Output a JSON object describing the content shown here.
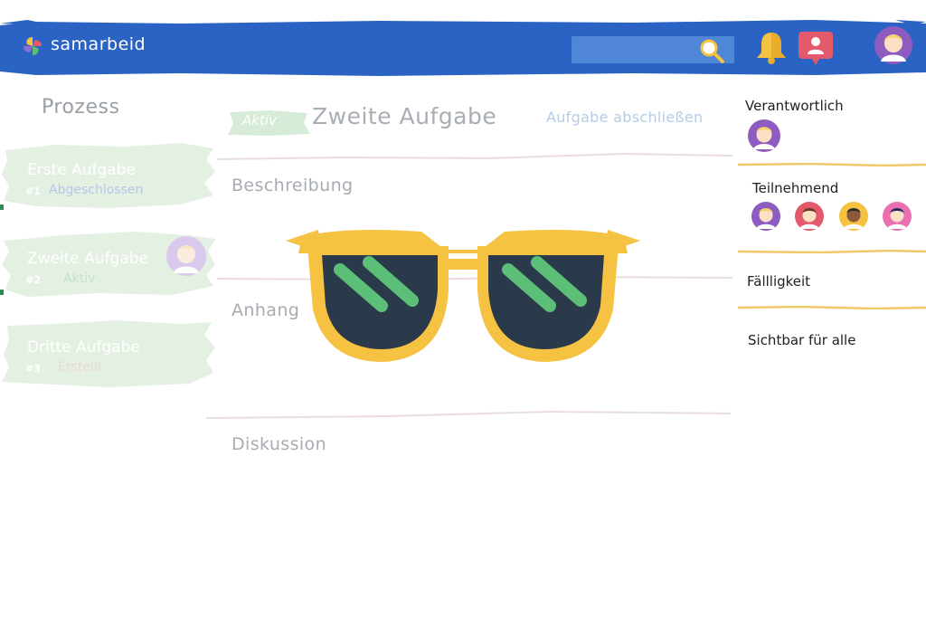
{
  "app": {
    "name": "samarbeid"
  },
  "header": {
    "icons": [
      "logo-icon",
      "search-icon",
      "bell-icon",
      "profile-badge-icon",
      "user-avatar"
    ],
    "colors": {
      "bar": "#2a63c4",
      "search": "#4f86d6",
      "bell": "#f5c242",
      "badge": "#e55a6a"
    }
  },
  "process": {
    "title": "Prozess",
    "tasks": [
      {
        "name": "Erste Aufgabe",
        "number": "#1",
        "status": "Abgeschlossen",
        "status_color": "#b6c6ea"
      },
      {
        "name": "Zweite Aufgabe",
        "number": "#2",
        "status": "Aktiv",
        "status_color": "#c3e2c8"
      },
      {
        "name": "Dritte Aufgabe",
        "number": "#3",
        "status": "Erstellt",
        "status_color": "#ead7da"
      }
    ],
    "card_color": "#e3f0e2"
  },
  "task": {
    "status": "Aktiv",
    "title": "Zweite Aufgabe",
    "complete_action": "Aufgabe abschließen",
    "sections": {
      "description": "Beschreibung",
      "attachment": "Anhang",
      "discussion": "Diskussion"
    }
  },
  "details": {
    "responsible": "Verantwortlich",
    "participants": "Teilnehmend",
    "due": "Fällligkeit",
    "visibility": "Sichtbar für alle"
  },
  "overlay": {
    "icon": "sunglasses-icon",
    "frame_color": "#f5c242",
    "lens_color": "#2b3a4a",
    "shine_color": "#5cbf78"
  }
}
